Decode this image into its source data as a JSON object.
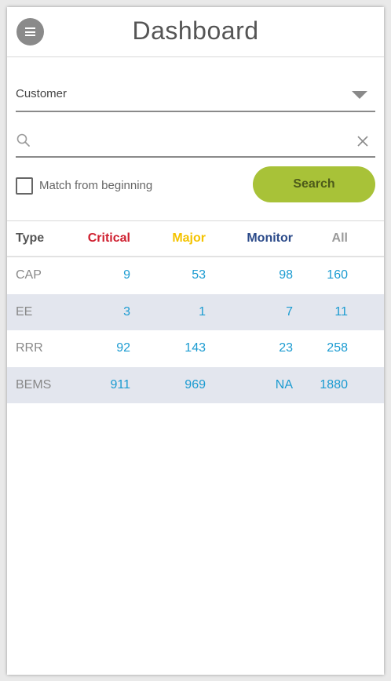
{
  "header": {
    "title": "Dashboard"
  },
  "colors": {
    "accent_button": "#a8c238",
    "critical": "#cf2030",
    "major": "#f4c300",
    "monitor": "#2c4b8a",
    "all": "#9a9a9a",
    "link": "#1b9bd1",
    "alt_row": "#e3e6ee"
  },
  "filter": {
    "selected": "Customer",
    "search_value": "",
    "search_placeholder": "",
    "match_label": "Match from beginning",
    "match_checked": false,
    "search_button": "Search"
  },
  "table": {
    "headers": {
      "type": "Type",
      "critical": "Critical",
      "major": "Major",
      "monitor": "Monitor",
      "all": "All"
    },
    "rows": [
      {
        "type": "CAP",
        "critical": "9",
        "major": "53",
        "monitor": "98",
        "all": "160"
      },
      {
        "type": "EE",
        "critical": "3",
        "major": "1",
        "monitor": "7",
        "all": "11"
      },
      {
        "type": "RRR",
        "critical": "92",
        "major": "143",
        "monitor": "23",
        "all": "258"
      },
      {
        "type": "BEMS",
        "critical": "911",
        "major": "969",
        "monitor": "NA",
        "all": "1880"
      }
    ]
  }
}
